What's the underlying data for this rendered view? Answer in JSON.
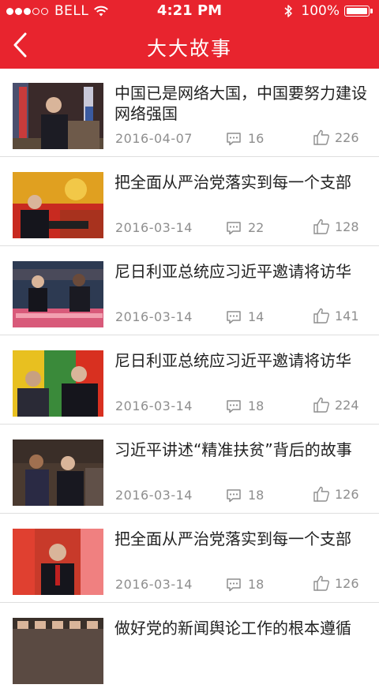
{
  "status_bar": {
    "carrier": "BELL",
    "time": "4:21 PM",
    "battery": "100%"
  },
  "header": {
    "title": "大大故事",
    "back_icon": "chevron-left-icon"
  },
  "colors": {
    "brand_red": "#e8242e",
    "text_primary": "#222222",
    "text_secondary": "#8e8e8e"
  },
  "articles": [
    {
      "title": "中国已是网络大国，中国要努力建设网络强国",
      "date": "2016-04-07",
      "comments": "16",
      "likes": "226"
    },
    {
      "title": "把全面从严治党落实到每一个支部",
      "date": "2016-03-14",
      "comments": "22",
      "likes": "128"
    },
    {
      "title": "尼日利亚总统应习近平邀请将访华",
      "date": "2016-03-14",
      "comments": "14",
      "likes": "141"
    },
    {
      "title": "尼日利亚总统应习近平邀请将访华",
      "date": "2016-03-14",
      "comments": "18",
      "likes": "224"
    },
    {
      "title": "习近平讲述“精准扶贫”背后的故事",
      "date": "2016-03-14",
      "comments": "18",
      "likes": "126"
    },
    {
      "title": "把全面从严治党落实到每一个支部",
      "date": "2016-03-14",
      "comments": "18",
      "likes": "126"
    },
    {
      "title": "做好党的新闻舆论工作的根本遵循",
      "date": "",
      "comments": "",
      "likes": ""
    }
  ]
}
